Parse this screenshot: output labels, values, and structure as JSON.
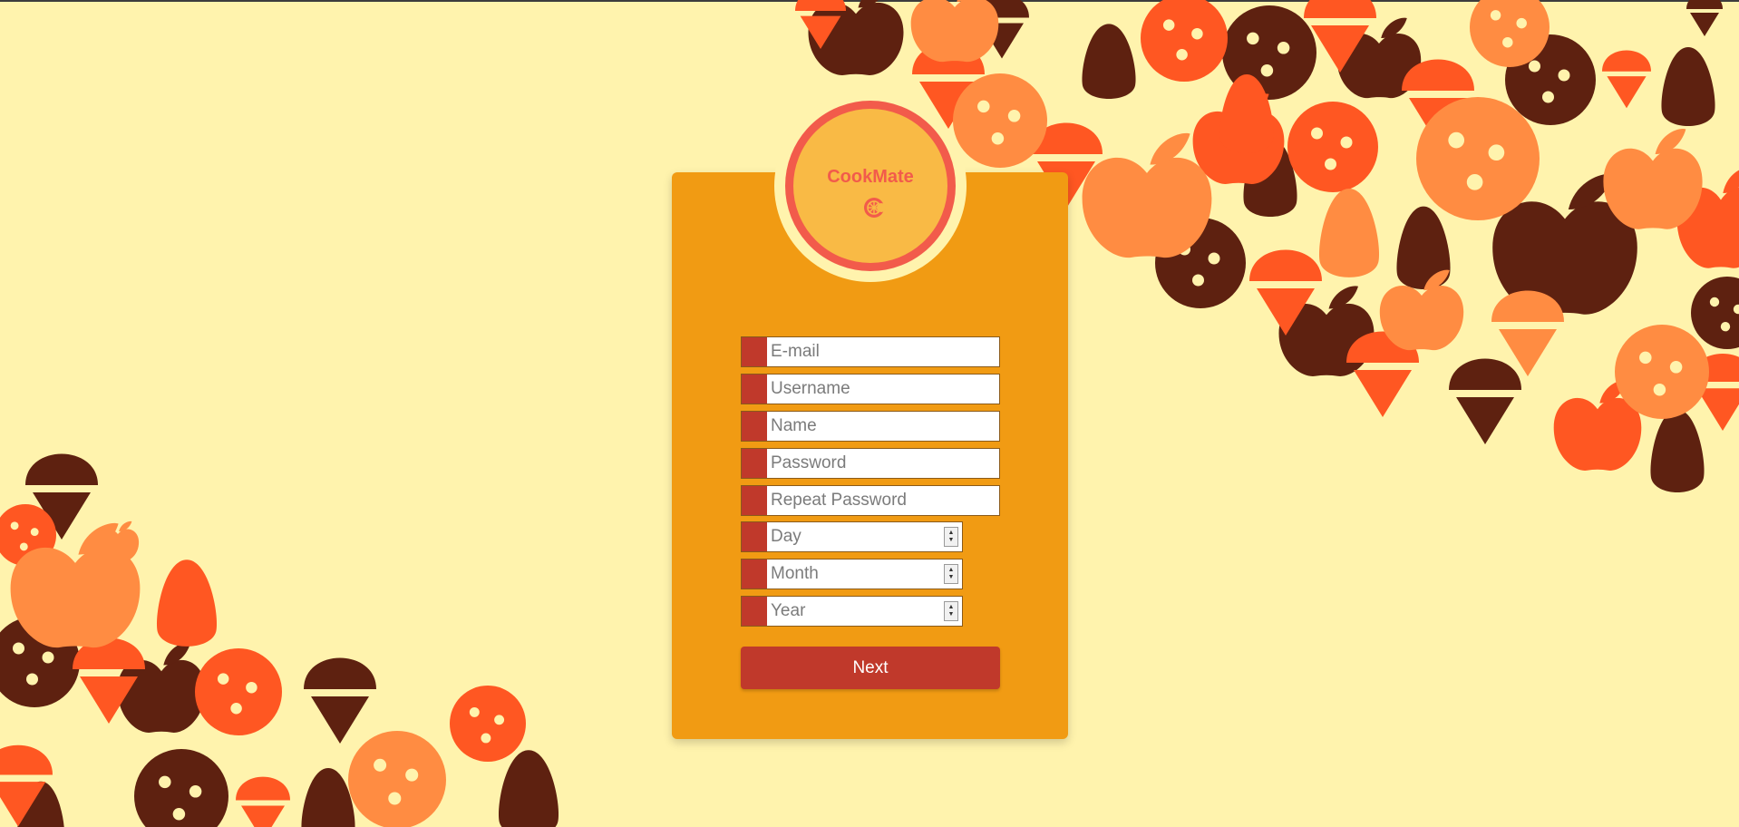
{
  "app": {
    "logo_text": "CookMate"
  },
  "form": {
    "fields": [
      {
        "placeholder": "E-mail"
      },
      {
        "placeholder": "Username"
      },
      {
        "placeholder": "Name"
      },
      {
        "placeholder": "Password"
      },
      {
        "placeholder": "Repeat Password"
      },
      {
        "placeholder": "Day"
      },
      {
        "placeholder": "Month"
      },
      {
        "placeholder": "Year"
      }
    ],
    "submit_label": "Next"
  },
  "colors": {
    "page_background": "#fff3ad",
    "card": "#f19b13",
    "accent_red": "#c0392b",
    "logo_ring": "#f25b4b",
    "logo_fill": "#f9ba45",
    "dark_brown": "#5e2110",
    "orange": "#ff5722",
    "light_orange": "#ff8c42"
  },
  "icons": {
    "logo": "orange-slice-icon",
    "background_pattern": [
      "cookie-icon",
      "ice-cream-icon",
      "apple-icon",
      "avocado-icon"
    ]
  }
}
